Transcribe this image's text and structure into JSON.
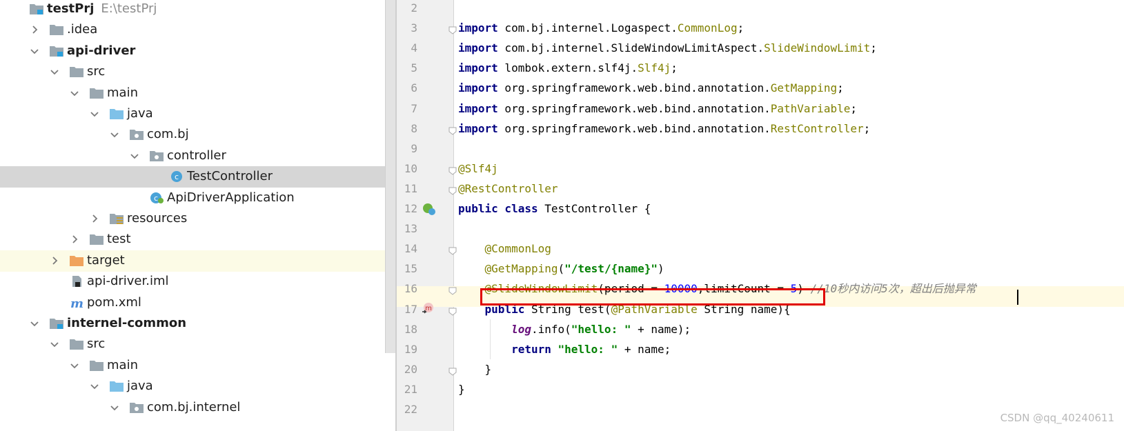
{
  "tree": {
    "rows": [
      {
        "label": "testPrj",
        "path": "E:\\testPrj",
        "bold": true,
        "icon": "module-folder-icon",
        "arrow": "none",
        "indent": 0
      },
      {
        "label": ".idea",
        "bold": false,
        "icon": "folder-icon",
        "arrow": "collapsed",
        "indent": 1
      },
      {
        "label": "api-driver",
        "bold": true,
        "icon": "module-folder-icon",
        "arrow": "expanded",
        "indent": 1
      },
      {
        "label": "src",
        "bold": false,
        "icon": "folder-icon",
        "arrow": "expanded",
        "indent": 2
      },
      {
        "label": "main",
        "bold": false,
        "icon": "folder-icon",
        "arrow": "expanded",
        "indent": 3
      },
      {
        "label": "java",
        "bold": false,
        "icon": "source-folder-icon",
        "arrow": "expanded",
        "indent": 4
      },
      {
        "label": "com.bj",
        "bold": false,
        "icon": "package-icon",
        "arrow": "expanded",
        "indent": 5
      },
      {
        "label": "controller",
        "bold": false,
        "icon": "package-icon",
        "arrow": "expanded",
        "indent": 6
      },
      {
        "label": "TestController",
        "bold": false,
        "icon": "class-icon",
        "arrow": "none",
        "indent": 7,
        "selected": true
      },
      {
        "label": "ApiDriverApplication",
        "bold": false,
        "icon": "spring-boot-class-icon",
        "arrow": "none",
        "indent": 6
      },
      {
        "label": "resources",
        "bold": false,
        "icon": "resources-folder-icon",
        "arrow": "collapsed",
        "indent": 4
      },
      {
        "label": "test",
        "bold": false,
        "icon": "folder-icon",
        "arrow": "collapsed",
        "indent": 3
      },
      {
        "label": "target",
        "bold": false,
        "icon": "excluded-folder-icon",
        "arrow": "collapsed",
        "indent": 2,
        "excluded": true
      },
      {
        "label": "api-driver.iml",
        "bold": false,
        "icon": "iml-file-icon",
        "arrow": "none",
        "indent": 2
      },
      {
        "label": "pom.xml",
        "bold": false,
        "icon": "maven-icon",
        "arrow": "none",
        "indent": 2
      },
      {
        "label": "internel-common",
        "bold": true,
        "icon": "module-folder-icon",
        "arrow": "expanded",
        "indent": 1
      },
      {
        "label": "src",
        "bold": false,
        "icon": "folder-icon",
        "arrow": "expanded",
        "indent": 2
      },
      {
        "label": "main",
        "bold": false,
        "icon": "folder-icon",
        "arrow": "expanded",
        "indent": 3
      },
      {
        "label": "java",
        "bold": false,
        "icon": "source-folder-icon",
        "arrow": "expanded",
        "indent": 4
      },
      {
        "label": "com.bj.internel",
        "bold": false,
        "icon": "package-icon",
        "arrow": "expanded",
        "indent": 5
      }
    ]
  },
  "editor": {
    "line_numbers": [
      "2",
      "3",
      "4",
      "5",
      "6",
      "7",
      "8",
      "9",
      "10",
      "11",
      "12",
      "13",
      "14",
      "15",
      "16",
      "17",
      "18",
      "19",
      "20",
      "21",
      "22"
    ],
    "current_line": "16",
    "lines": [
      [],
      [
        {
          "t": "import",
          "c": "kw"
        },
        {
          "t": " com.bj.internel.Logaspect.",
          "c": ""
        },
        {
          "t": "CommonLog",
          "c": "imp"
        },
        {
          "t": ";",
          "c": ""
        }
      ],
      [
        {
          "t": "import",
          "c": "kw"
        },
        {
          "t": " com.bj.internel.SlideWindowLimitAspect.",
          "c": ""
        },
        {
          "t": "SlideWindowLimit",
          "c": "imp"
        },
        {
          "t": ";",
          "c": ""
        }
      ],
      [
        {
          "t": "import",
          "c": "kw"
        },
        {
          "t": " lombok.extern.slf4j.",
          "c": ""
        },
        {
          "t": "Slf4j",
          "c": "imp"
        },
        {
          "t": ";",
          "c": ""
        }
      ],
      [
        {
          "t": "import",
          "c": "kw"
        },
        {
          "t": " org.springframework.web.bind.annotation.",
          "c": ""
        },
        {
          "t": "GetMapping",
          "c": "imp"
        },
        {
          "t": ";",
          "c": ""
        }
      ],
      [
        {
          "t": "import",
          "c": "kw"
        },
        {
          "t": " org.springframework.web.bind.annotation.",
          "c": ""
        },
        {
          "t": "PathVariable",
          "c": "imp"
        },
        {
          "t": ";",
          "c": ""
        }
      ],
      [
        {
          "t": "import",
          "c": "kw"
        },
        {
          "t": " org.springframework.web.bind.annotation.",
          "c": ""
        },
        {
          "t": "RestController",
          "c": "imp"
        },
        {
          "t": ";",
          "c": ""
        }
      ],
      [],
      [
        {
          "t": "@Slf4j",
          "c": "ann"
        }
      ],
      [
        {
          "t": "@RestController",
          "c": "ann"
        }
      ],
      [
        {
          "t": "public class",
          "c": "kw"
        },
        {
          "t": " TestController {",
          "c": ""
        }
      ],
      [],
      [
        {
          "t": "    @CommonLog",
          "c": "ann"
        }
      ],
      [
        {
          "t": "    @GetMapping",
          "c": "ann"
        },
        {
          "t": "(",
          "c": ""
        },
        {
          "t": "\"/test/{name}\"",
          "c": "str"
        },
        {
          "t": ")",
          "c": ""
        }
      ],
      [
        {
          "t": "    @SlideWindowLimit",
          "c": "ann"
        },
        {
          "t": "(period = ",
          "c": ""
        },
        {
          "t": "10000",
          "c": "num"
        },
        {
          "t": ",limitCount = ",
          "c": ""
        },
        {
          "t": "5",
          "c": "num"
        },
        {
          "t": ") ",
          "c": ""
        },
        {
          "t": "//10秒内访问5次，超出后抛异常",
          "c": "cmt"
        }
      ],
      [
        {
          "t": "    public",
          "c": "kw"
        },
        {
          "t": " String test(",
          "c": ""
        },
        {
          "t": "@PathVariable",
          "c": "ann"
        },
        {
          "t": " String name){",
          "c": ""
        }
      ],
      [
        {
          "t": "        ",
          "c": ""
        },
        {
          "t": "log",
          "c": "field"
        },
        {
          "t": ".info(",
          "c": ""
        },
        {
          "t": "\"hello: \"",
          "c": "str"
        },
        {
          "t": " + name);",
          "c": ""
        }
      ],
      [
        {
          "t": "        return",
          "c": "kw"
        },
        {
          "t": " ",
          "c": ""
        },
        {
          "t": "\"hello: \"",
          "c": "str"
        },
        {
          "t": " + name;",
          "c": ""
        }
      ],
      [
        {
          "t": "    }",
          "c": ""
        }
      ],
      [
        {
          "t": "}",
          "c": ""
        }
      ],
      []
    ]
  },
  "watermark": "CSDN @qq_40240611"
}
